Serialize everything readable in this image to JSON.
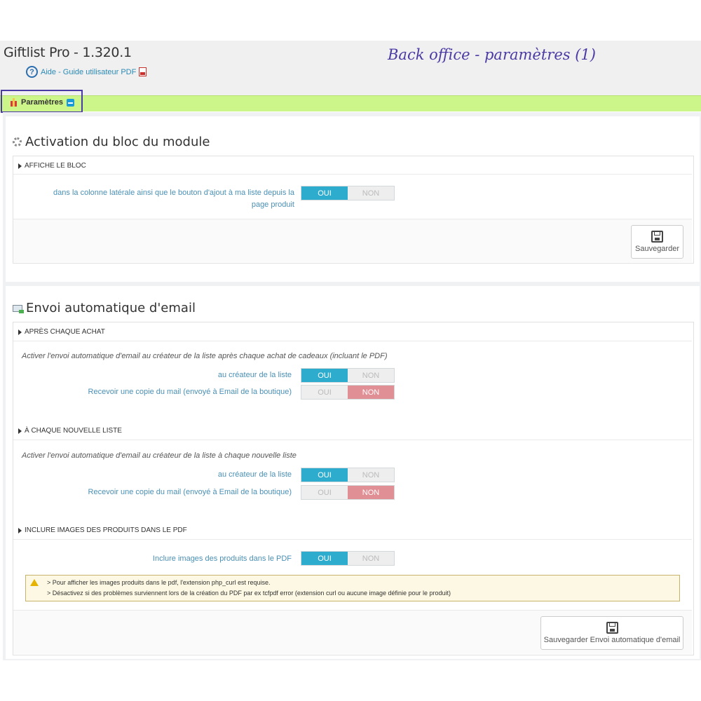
{
  "app": {
    "title": "Giftlist Pro - 1.320.1",
    "help_link": "Aide - Guide utilisateur PDF",
    "annotation": "Back office - paramètres (1)"
  },
  "tab": {
    "label": "Paramètres"
  },
  "section1": {
    "title": "Activation du bloc du module",
    "subheading": "AFFICHE LE BLOC",
    "field_label_line1": "dans la colonne latérale ainsi que le bouton d'ajout à ma liste depuis la",
    "field_label_line2": "page produit",
    "toggle": {
      "on": "OUI",
      "off": "NON",
      "value": "OUI"
    },
    "save_label": "Sauvegarder"
  },
  "section2": {
    "title": "Envoi automatique d'email",
    "group1": {
      "subheading": "APRÈS CHAQUE ACHAT",
      "description": "Activer l'envoi automatique d'email au créateur de la liste après chaque achat de cadeaux (incluant le PDF)",
      "rows": [
        {
          "label": "au créateur de la liste",
          "on": "OUI",
          "off": "NON",
          "value": "OUI"
        },
        {
          "label": "Recevoir une copie du mail (envoyé à Email de la boutique)",
          "on": "OUI",
          "off": "NON",
          "value": "NON"
        }
      ]
    },
    "group2": {
      "subheading": "À CHAQUE NOUVELLE LISTE",
      "description": "Activer l'envoi automatique d'email au créateur de la liste à chaque nouvelle liste",
      "rows": [
        {
          "label": "au créateur de la liste",
          "on": "OUI",
          "off": "NON",
          "value": "OUI"
        },
        {
          "label": "Recevoir une copie du mail (envoyé à Email de la boutique)",
          "on": "OUI",
          "off": "NON",
          "value": "NON"
        }
      ]
    },
    "group3": {
      "subheading": "INCLURE IMAGES DES PRODUITS DANS LE PDF",
      "rows": [
        {
          "label": "Inclure images des produits dans le PDF",
          "on": "OUI",
          "off": "NON",
          "value": "OUI"
        }
      ],
      "warning_line1": "> Pour afficher les images produits dans le pdf, l'extension php_curl est requise.",
      "warning_line2": "> Désactivez si des problèmes surviennent lors de la création du PDF par ex tcfpdf error (extension curl ou aucune image définie pour le produit)"
    },
    "save_label": "Sauvegarder Envoi automatique d'email"
  },
  "colors": {
    "accent": "#2eacce",
    "off": "#e08f95",
    "tabbar": "#ccf58a",
    "annotation": "#4a3aa3"
  }
}
